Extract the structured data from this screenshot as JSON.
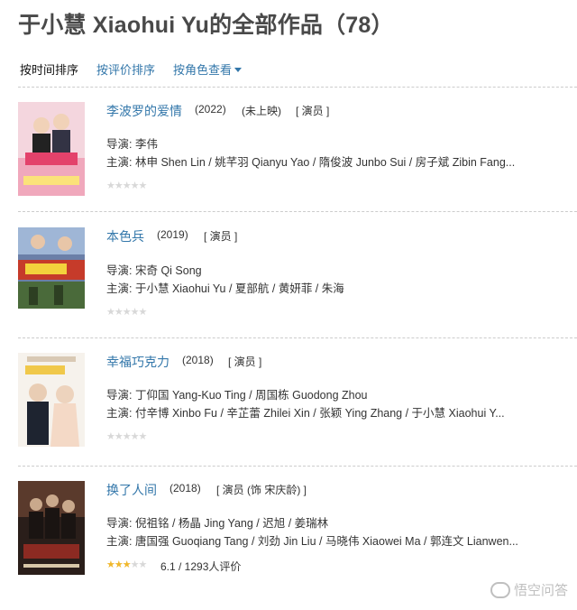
{
  "page": {
    "title": "于小慧 Xiaohui Yu的全部作品（78）"
  },
  "sort": {
    "by_time": "按时间排序",
    "by_rating": "按评价排序",
    "by_role": "按角色查看"
  },
  "movies": [
    {
      "title": "李波罗的爱情",
      "year": "(2022)",
      "status": "(未上映)",
      "role": "[ 演员 ]",
      "director_label": "导演:",
      "director": "李伟",
      "cast_label": "主演:",
      "cast": "林申 Shen Lin / 姚芊羽 Qianyu Yao / 隋俊波 Junbo Sui / 房子斌 Zibin Fang...",
      "rating": 0,
      "rating_text": ""
    },
    {
      "title": "本色兵",
      "year": "(2019)",
      "status": "",
      "role": "[ 演员 ]",
      "director_label": "导演:",
      "director": "宋奇 Qi Song",
      "cast_label": "主演:",
      "cast": "于小慧 Xiaohui Yu / 夏部航 / 黄妍菲 / 朱海",
      "rating": 0,
      "rating_text": ""
    },
    {
      "title": "幸福巧克力",
      "year": "(2018)",
      "status": "",
      "role": "[ 演员 ]",
      "director_label": "导演:",
      "director": "丁仰国 Yang-Kuo Ting / 周国栋 Guodong Zhou",
      "cast_label": "主演:",
      "cast": "付辛博 Xinbo Fu / 辛芷蕾 Zhilei Xin / 张颖 Ying Zhang / 于小慧 Xiaohui Y...",
      "rating": 0,
      "rating_text": ""
    },
    {
      "title": "换了人间",
      "year": "(2018)",
      "status": "",
      "role": "[ 演员 (饰 宋庆龄) ]",
      "director_label": "导演:",
      "director": "倪祖铭 / 杨晶 Jing Yang / 迟旭 / 姜瑞林",
      "cast_label": "主演:",
      "cast": "唐国强 Guoqiang Tang / 刘劲 Jin Liu / 马晓伟 Xiaowei Ma / 郭连文 Lianwen...",
      "rating": 3,
      "rating_text": "6.1 / 1293人评价"
    }
  ],
  "watermark": "悟空问答",
  "colors": {
    "link": "#3377aa",
    "star_on": "#f0b72a",
    "star_off": "#d8d8d8",
    "title": "#494949"
  }
}
